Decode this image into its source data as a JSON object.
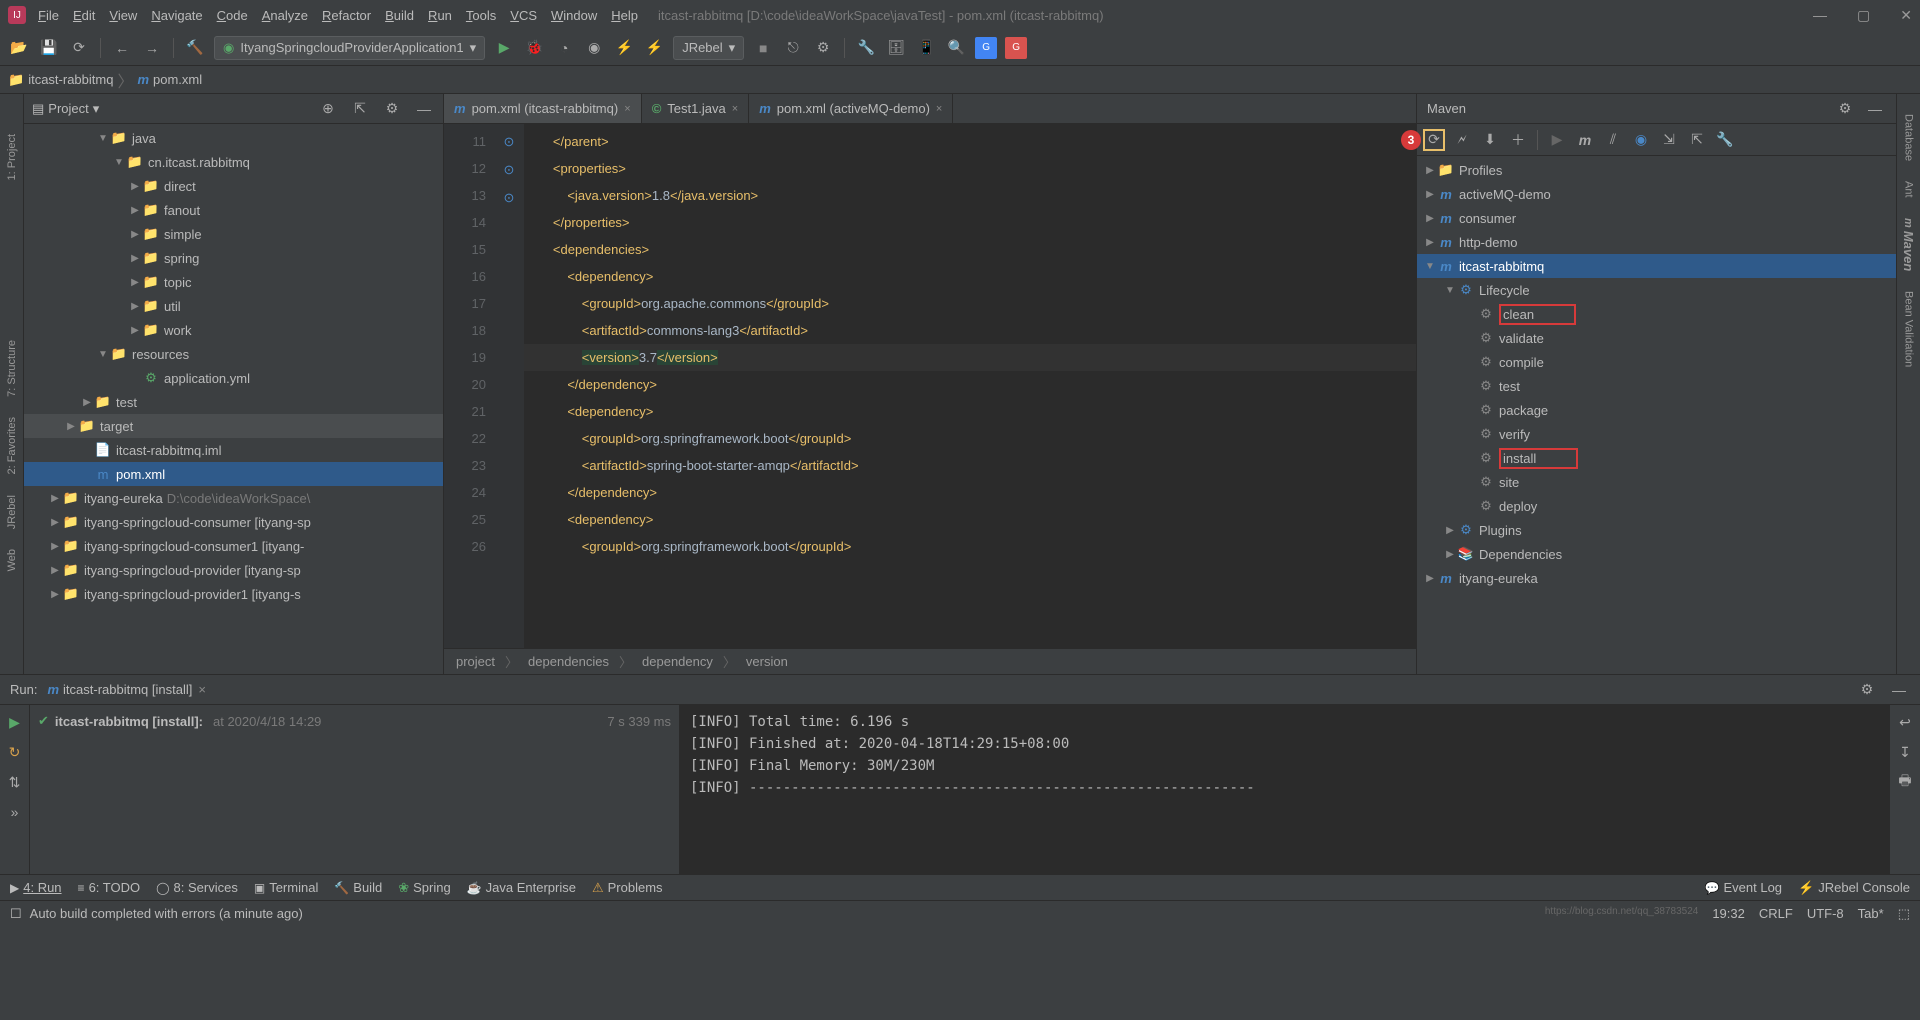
{
  "titlebar": {
    "menus": [
      "File",
      "Edit",
      "View",
      "Navigate",
      "Code",
      "Analyze",
      "Refactor",
      "Build",
      "Run",
      "Tools",
      "VCS",
      "Window",
      "Help"
    ],
    "title": "itcast-rabbitmq [D:\\code\\ideaWorkSpace\\javaTest] - pom.xml (itcast-rabbitmq)"
  },
  "toolbar": {
    "runconfig": "ItyangSpringcloudProviderApplication1",
    "jrebel": "JRebel"
  },
  "breadcrumb": {
    "root": "itcast-rabbitmq",
    "file": "pom.xml"
  },
  "project": {
    "title": "Project",
    "tree": [
      {
        "indent": 4,
        "arrow": "▼",
        "icon": "📁",
        "iconcolor": "#4a88c7",
        "label": "java"
      },
      {
        "indent": 5,
        "arrow": "▼",
        "icon": "📁",
        "iconcolor": "#888",
        "label": "cn.itcast.rabbitmq"
      },
      {
        "indent": 6,
        "arrow": "▶",
        "icon": "📁",
        "iconcolor": "#888",
        "label": "direct"
      },
      {
        "indent": 6,
        "arrow": "▶",
        "icon": "📁",
        "iconcolor": "#888",
        "label": "fanout"
      },
      {
        "indent": 6,
        "arrow": "▶",
        "icon": "📁",
        "iconcolor": "#888",
        "label": "simple"
      },
      {
        "indent": 6,
        "arrow": "▶",
        "icon": "📁",
        "iconcolor": "#888",
        "label": "spring"
      },
      {
        "indent": 6,
        "arrow": "▶",
        "icon": "📁",
        "iconcolor": "#888",
        "label": "topic"
      },
      {
        "indent": 6,
        "arrow": "▶",
        "icon": "📁",
        "iconcolor": "#888",
        "label": "util"
      },
      {
        "indent": 6,
        "arrow": "▶",
        "icon": "📁",
        "iconcolor": "#888",
        "label": "work"
      },
      {
        "indent": 4,
        "arrow": "▼",
        "icon": "📁",
        "iconcolor": "#888",
        "label": "resources"
      },
      {
        "indent": 6,
        "arrow": "",
        "icon": "⚙",
        "iconcolor": "#59a869",
        "label": "application.yml"
      },
      {
        "indent": 3,
        "arrow": "▶",
        "icon": "📁",
        "iconcolor": "#888",
        "label": "test"
      },
      {
        "indent": 2,
        "arrow": "▶",
        "icon": "📁",
        "iconcolor": "#c77b3a",
        "label": "target",
        "sel": false,
        "hl": true
      },
      {
        "indent": 3,
        "arrow": "",
        "icon": "📄",
        "iconcolor": "#888",
        "label": "itcast-rabbitmq.iml"
      },
      {
        "indent": 3,
        "arrow": "",
        "icon": "m",
        "iconcolor": "#4a88c7",
        "label": "pom.xml",
        "sel": true
      },
      {
        "indent": 1,
        "arrow": "▶",
        "icon": "📁",
        "iconcolor": "#888",
        "label": "ityang-eureka",
        "dim": "D:\\code\\ideaWorkSpace\\"
      },
      {
        "indent": 1,
        "arrow": "▶",
        "icon": "📁",
        "iconcolor": "#888",
        "label": "ityang-springcloud-consumer [ityang-sp"
      },
      {
        "indent": 1,
        "arrow": "▶",
        "icon": "📁",
        "iconcolor": "#888",
        "label": "ityang-springcloud-consumer1 [ityang-"
      },
      {
        "indent": 1,
        "arrow": "▶",
        "icon": "📁",
        "iconcolor": "#888",
        "label": "ityang-springcloud-provider [ityang-sp"
      },
      {
        "indent": 1,
        "arrow": "▶",
        "icon": "📁",
        "iconcolor": "#888",
        "label": "ityang-springcloud-provider1 [ityang-s"
      }
    ]
  },
  "editor": {
    "tabs": [
      {
        "icon": "m",
        "iconcolor": "#4a88c7",
        "label": "pom.xml (itcast-rabbitmq)",
        "active": true
      },
      {
        "icon": "©",
        "iconcolor": "#59a869",
        "label": "Test1.java"
      },
      {
        "icon": "m",
        "iconcolor": "#4a88c7",
        "label": "pom.xml (activeMQ-demo)"
      }
    ],
    "lines": [
      {
        "n": 11,
        "html": "        <span class='tag'>&lt;/parent&gt;</span>"
      },
      {
        "n": 12,
        "html": "        <span class='tag'>&lt;properties&gt;</span>"
      },
      {
        "n": 13,
        "html": "            <span class='tag'>&lt;java.version&gt;</span><span class='text'>1.8</span><span class='tag'>&lt;/java.version&gt;</span>"
      },
      {
        "n": 14,
        "html": "        <span class='tag'>&lt;/properties&gt;</span>"
      },
      {
        "n": 15,
        "html": "        <span class='tag'>&lt;dependencies&gt;</span>"
      },
      {
        "n": 16,
        "html": "            <span class='tag'>&lt;dependency&gt;</span>",
        "gi": "↑"
      },
      {
        "n": 17,
        "html": "                <span class='tag'>&lt;groupId&gt;</span><span class='text'>org.apache.commons</span><span class='tag'>&lt;/groupId&gt;</span>"
      },
      {
        "n": 18,
        "html": "                <span class='tag'>&lt;artifactId&gt;</span><span class='text'>commons-lang3</span><span class='tag'>&lt;/artifactId&gt;</span>"
      },
      {
        "n": 19,
        "html": "                <span class='diffadd'><span class='tag'>&lt;version&gt;</span></span><span class='text'>3.7</span><span class='diffadd'><span class='tag'>&lt;/version&gt;</span></span>",
        "hl": true
      },
      {
        "n": 20,
        "html": "            <span class='tag'>&lt;/dependency&gt;</span>"
      },
      {
        "n": 21,
        "html": "            <span class='tag'>&lt;dependency&gt;</span>",
        "gi": "↑"
      },
      {
        "n": 22,
        "html": "                <span class='tag'>&lt;groupId&gt;</span><span class='text'>org.springframework.boot</span><span class='tag'>&lt;/groupId&gt;</span>"
      },
      {
        "n": 23,
        "html": "                <span class='tag'>&lt;artifactId&gt;</span><span class='text'>spring-boot-starter-amqp</span><span class='tag'>&lt;/artifactId&gt;</span>"
      },
      {
        "n": 24,
        "html": "            <span class='tag'>&lt;/dependency&gt;</span>"
      },
      {
        "n": 25,
        "html": "            <span class='tag'>&lt;dependency&gt;</span>",
        "gi": "↑"
      },
      {
        "n": 26,
        "html": "                <span class='tag'>&lt;groupId&gt;</span><span class='text'>org.springframework.boot</span><span class='tag'>&lt;/groupId&gt;</span>"
      }
    ],
    "crumb": [
      "project",
      "dependencies",
      "dependency",
      "version"
    ]
  },
  "maven": {
    "title": "Maven",
    "tree": [
      {
        "indent": 0,
        "arrow": "▶",
        "icon": "📁",
        "label": "Profiles"
      },
      {
        "indent": 0,
        "arrow": "▶",
        "icon": "m",
        "label": "activeMQ-demo"
      },
      {
        "indent": 0,
        "arrow": "▶",
        "icon": "m",
        "label": "consumer"
      },
      {
        "indent": 0,
        "arrow": "▶",
        "icon": "m",
        "label": "http-demo"
      },
      {
        "indent": 0,
        "arrow": "▼",
        "icon": "m",
        "label": "itcast-rabbitmq",
        "sel": true
      },
      {
        "indent": 1,
        "arrow": "▼",
        "icon": "⚙",
        "label": "Lifecycle"
      },
      {
        "indent": 2,
        "arrow": "",
        "icon": "⚙",
        "label": "clean",
        "gear": true,
        "box": 1
      },
      {
        "indent": 2,
        "arrow": "",
        "icon": "⚙",
        "label": "validate",
        "gear": true
      },
      {
        "indent": 2,
        "arrow": "",
        "icon": "⚙",
        "label": "compile",
        "gear": true
      },
      {
        "indent": 2,
        "arrow": "",
        "icon": "⚙",
        "label": "test",
        "gear": true
      },
      {
        "indent": 2,
        "arrow": "",
        "icon": "⚙",
        "label": "package",
        "gear": true
      },
      {
        "indent": 2,
        "arrow": "",
        "icon": "⚙",
        "label": "verify",
        "gear": true
      },
      {
        "indent": 2,
        "arrow": "",
        "icon": "⚙",
        "label": "install",
        "gear": true,
        "box": 2
      },
      {
        "indent": 2,
        "arrow": "",
        "icon": "⚙",
        "label": "site",
        "gear": true
      },
      {
        "indent": 2,
        "arrow": "",
        "icon": "⚙",
        "label": "deploy",
        "gear": true
      },
      {
        "indent": 1,
        "arrow": "▶",
        "icon": "⚙",
        "label": "Plugins"
      },
      {
        "indent": 1,
        "arrow": "▶",
        "icon": "📚",
        "label": "Dependencies"
      },
      {
        "indent": 0,
        "arrow": "▶",
        "icon": "m",
        "label": "ityang-eureka"
      }
    ]
  },
  "run": {
    "title": "Run:",
    "tab": "itcast-rabbitmq [install]",
    "task": "itcast-rabbitmq [install]:",
    "taskdim": "at 2020/4/18 14:29",
    "tasktime": "7 s 339 ms",
    "out": [
      "[INFO] Total time: 6.196 s",
      "[INFO] Finished at: 2020-04-18T14:29:15+08:00",
      "[INFO] Final Memory: 30M/230M",
      "[INFO] ------------------------------------------------------------"
    ]
  },
  "toolwins": {
    "left": [
      "4: Run",
      "6: TODO",
      "8: Services",
      "Terminal",
      "Build",
      "Spring",
      "Java Enterprise",
      "Problems"
    ],
    "right": [
      "Event Log",
      "JRebel Console"
    ]
  },
  "status": {
    "msg": "Auto build completed with errors (a minute ago)",
    "right": [
      "19:32",
      "CRLF",
      "UTF-8",
      "Tab*",
      "⬚"
    ],
    "watermark": "https://blog.csdn.net/qq_38783524"
  },
  "sidetabs": {
    "left": [
      "1: Project",
      "7: Structure",
      "2: Favorites",
      "JRebel",
      "Web"
    ],
    "right": [
      "Database",
      "Ant",
      "Maven",
      "Bean Validation"
    ]
  }
}
